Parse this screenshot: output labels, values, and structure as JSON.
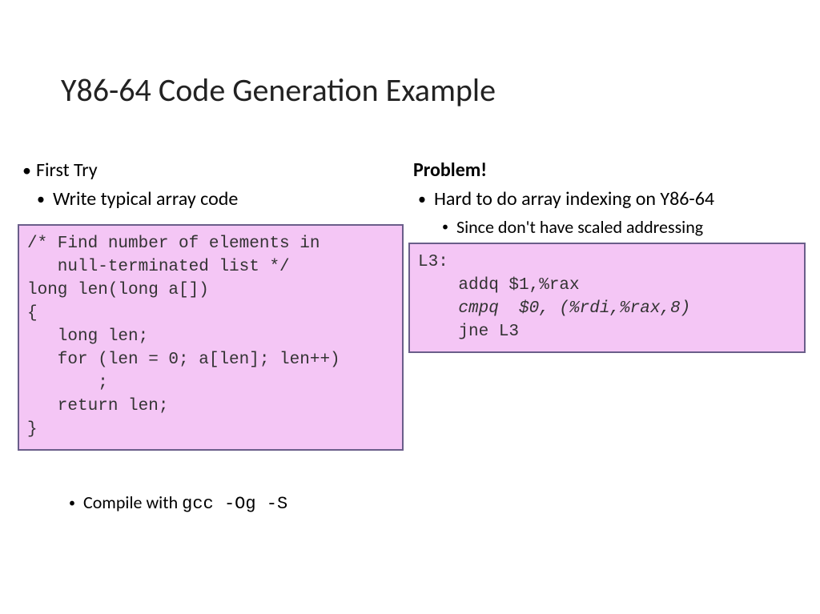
{
  "title": "Y86-64 Code Generation Example",
  "left": {
    "heading": "First Try",
    "bullet1": "Write typical array code",
    "code": "/* Find number of elements in\n   null-terminated list */\nlong len(long a[])\n{\n   long len;\n   for (len = 0; a[len]; len++)\n       ;\n   return len;\n}",
    "compile_prefix": "Compile with ",
    "compile_cmd": "gcc -Og -S"
  },
  "right": {
    "heading": "Problem!",
    "bullet1": "Hard to do array indexing on Y86-64",
    "sub1": "Since don't have scaled addressing",
    "code_line1": "L3:",
    "code_line2": "    addq $1,%rax",
    "code_line3": "    cmpq  $0, (%rdi,%rax,8)",
    "code_line4": "    jne L3"
  }
}
